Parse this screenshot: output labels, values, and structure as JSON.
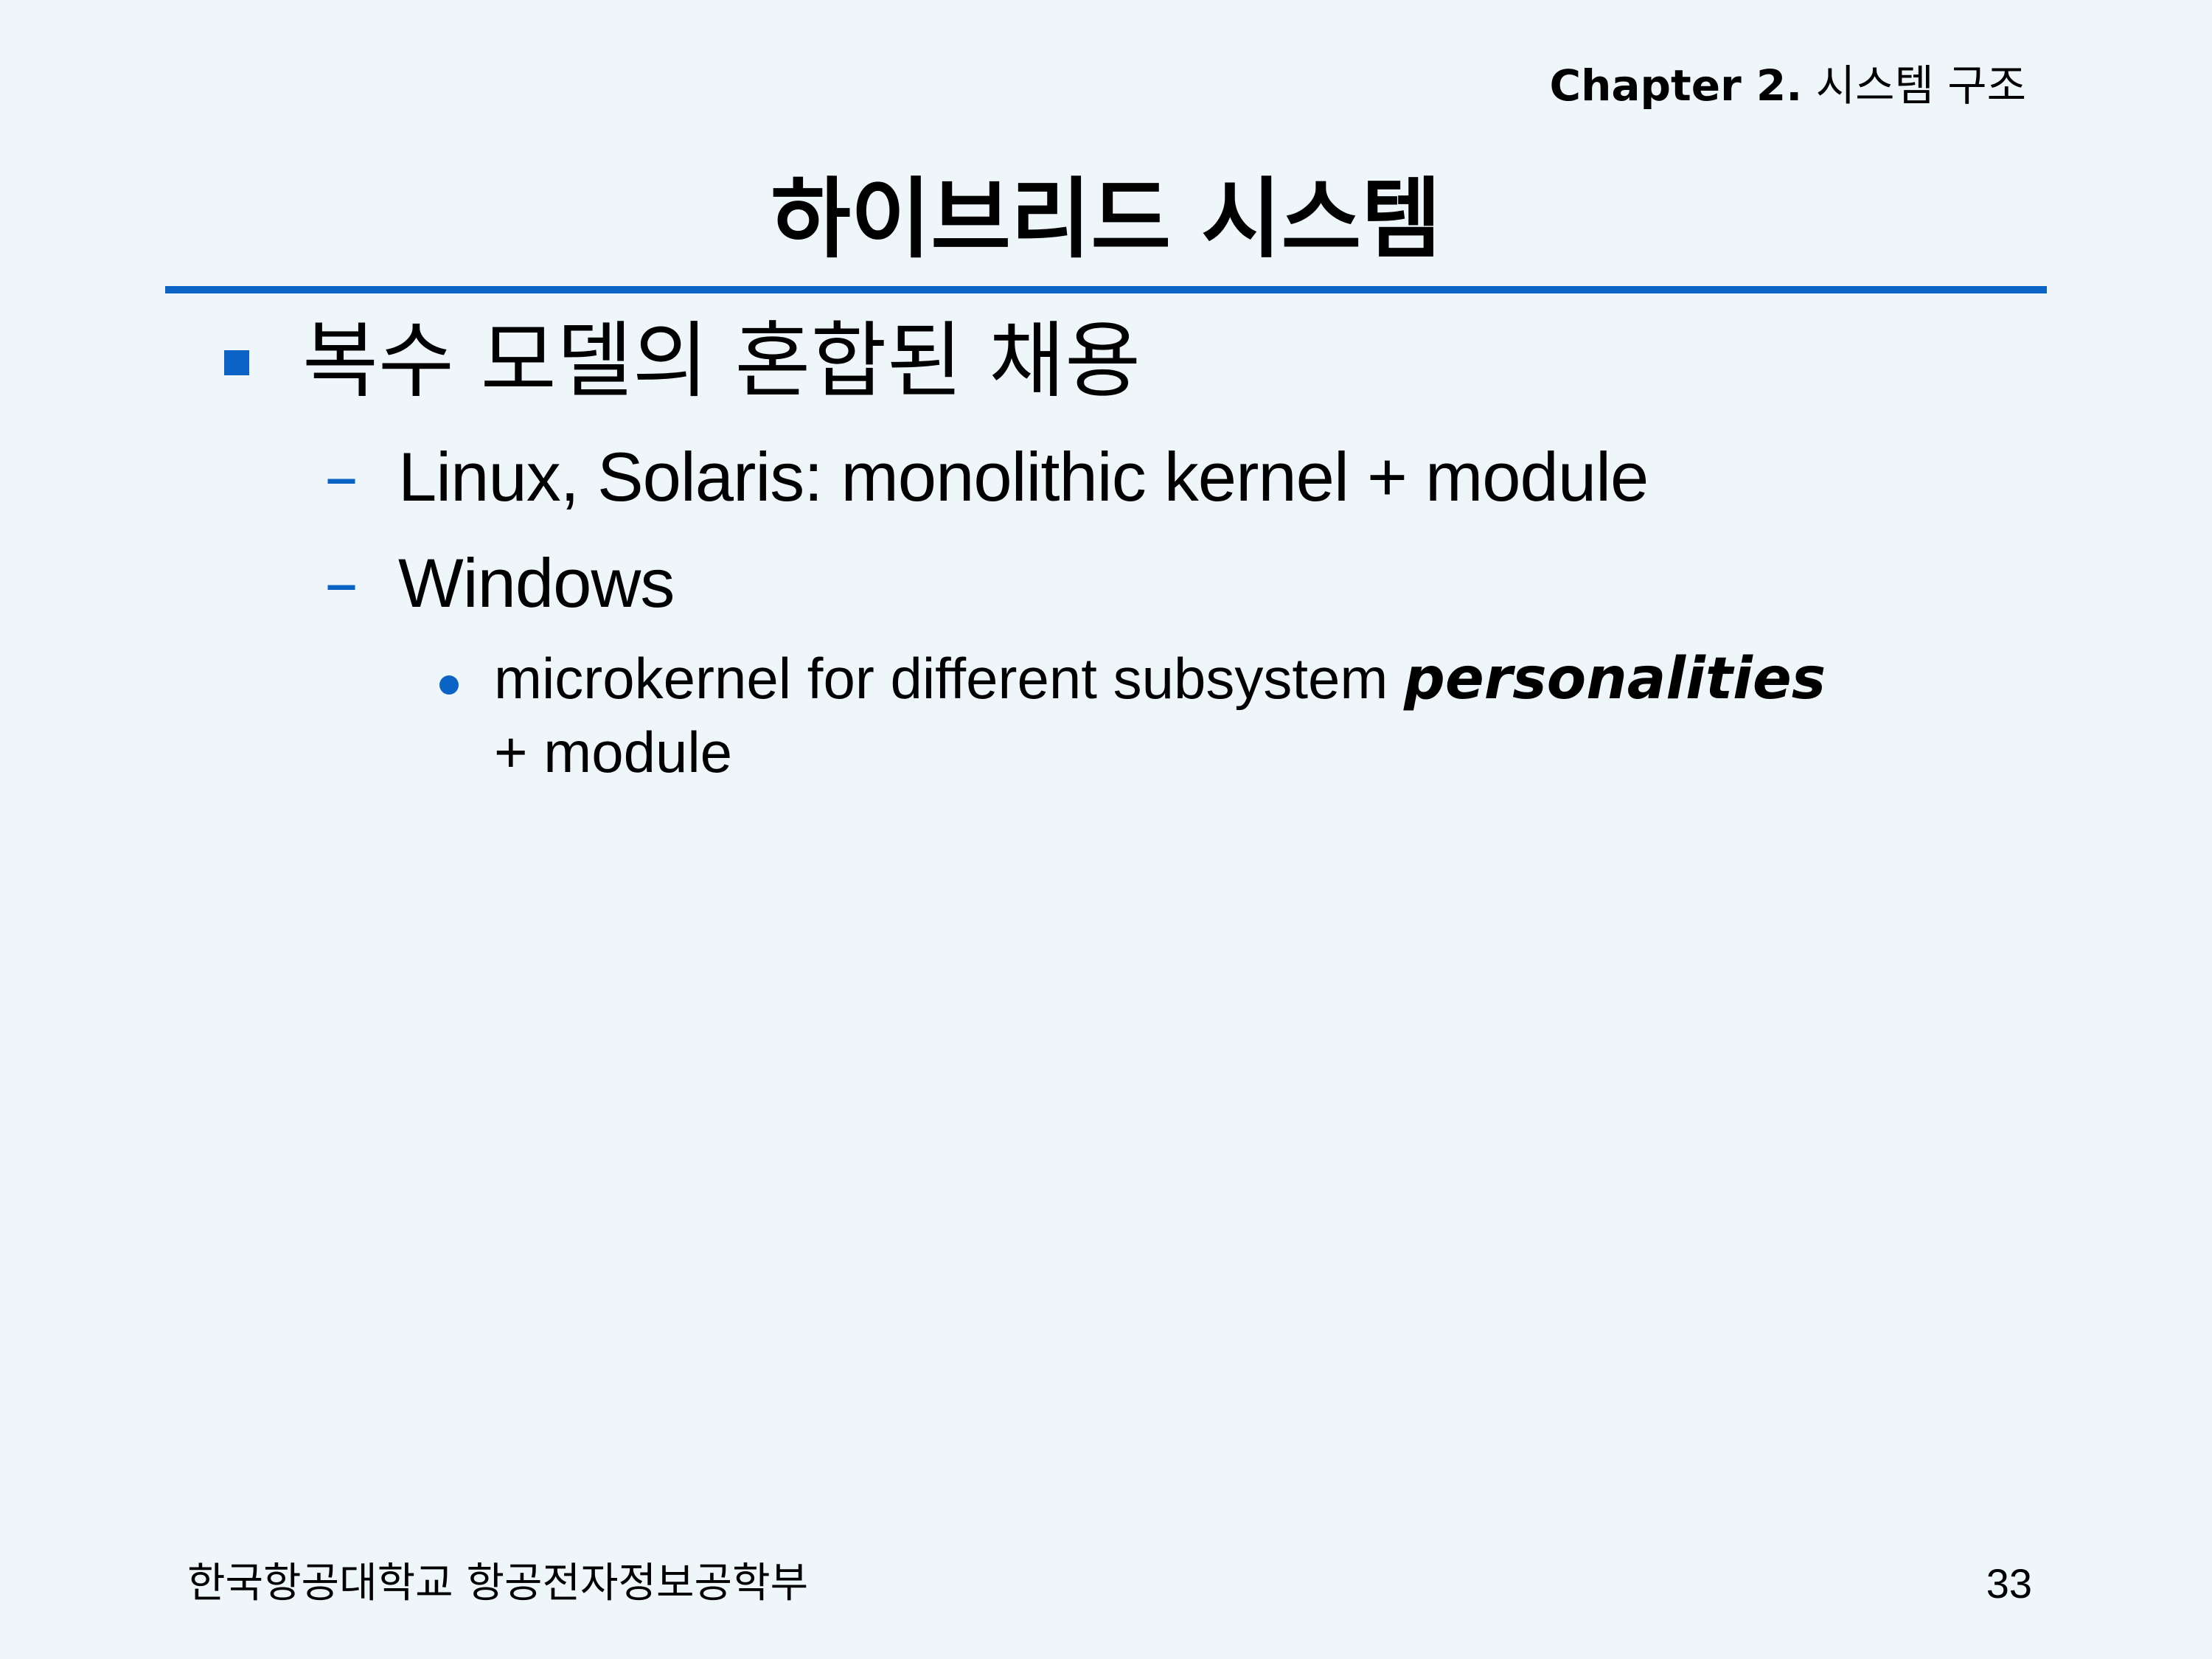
{
  "header": {
    "chapter_label": "Chapter 2.",
    "chapter_title": "시스템 구조"
  },
  "slide": {
    "title": "하이브리드 시스템",
    "bullet": "복수 모델의 혼합된 채용",
    "sub_bullets": [
      "Linux, Solaris: monolithic kernel + module",
      "Windows"
    ],
    "sub_sub_bullet": {
      "text": "microkernel for different subsystem",
      "emphasis": "personalities",
      "continuation": "+ module"
    }
  },
  "footer": {
    "institution": "한국항공대학교 항공전자정보공학부",
    "page_number": "33"
  },
  "colors": {
    "background": "#eef6fa",
    "accent": "#0b63c5"
  }
}
